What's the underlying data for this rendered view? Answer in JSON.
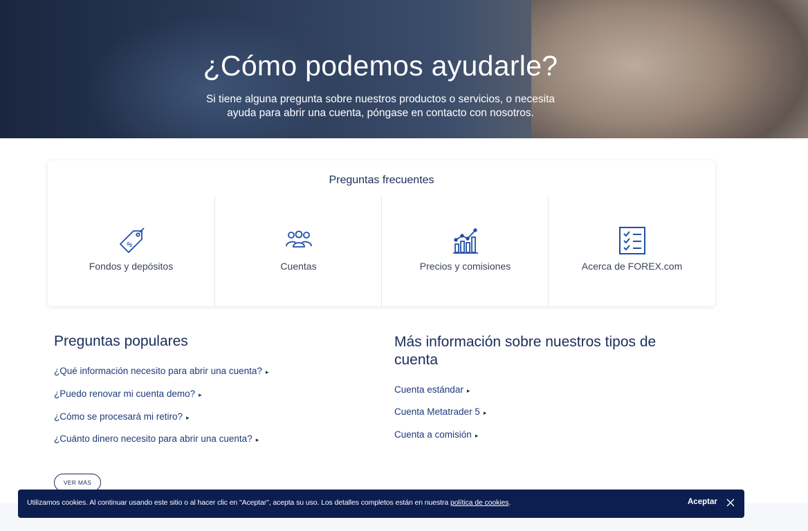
{
  "hero": {
    "title": "¿Cómo podemos ayudarle?",
    "subtitle_line1": "Si tiene alguna pregunta sobre nuestros productos o servicios, o necesita",
    "subtitle_line2": "ayuda para abrir una cuenta, póngase en contacto con nosotros."
  },
  "faq": {
    "title": "Preguntas frecuentes",
    "items": [
      {
        "label": "Fondos y depósitos",
        "icon": "money-tag-icon"
      },
      {
        "label": "Cuentas",
        "icon": "users-group-icon"
      },
      {
        "label": "Precios y comisiones",
        "icon": "growth-chart-icon"
      },
      {
        "label": "Acerca de FOREX.com",
        "icon": "checklist-icon"
      }
    ]
  },
  "popular": {
    "title": "Preguntas populares",
    "questions": [
      "¿Qué información necesito para abrir una cuenta?",
      "¿Puedo renovar mi cuenta demo?",
      "¿Cómo se procesará mi retiro?",
      "¿Cuánto dinero necesito para abrir una cuenta?"
    ],
    "more_button": "VER MÁS"
  },
  "account_info": {
    "title": "Más información sobre nuestros tipos de cuenta",
    "links": [
      "Cuenta estándar",
      "Cuenta Metatrader 5",
      "Cuenta a comisión"
    ]
  },
  "cookie": {
    "text": "Utilizamos cookies. Al continuar usando este sitio o al hacer clic en \"Aceptar\", acepta su uso. Los detalles completos están en nuestra ",
    "policy_link": "política de cookies",
    "period": ".",
    "accept": "Aceptar"
  },
  "colors": {
    "brand_navy": "#0b1e4f",
    "text_navy": "#1c2c5b",
    "icon_blue": "#1f4fa8"
  },
  "arrow_glyph": "▸"
}
